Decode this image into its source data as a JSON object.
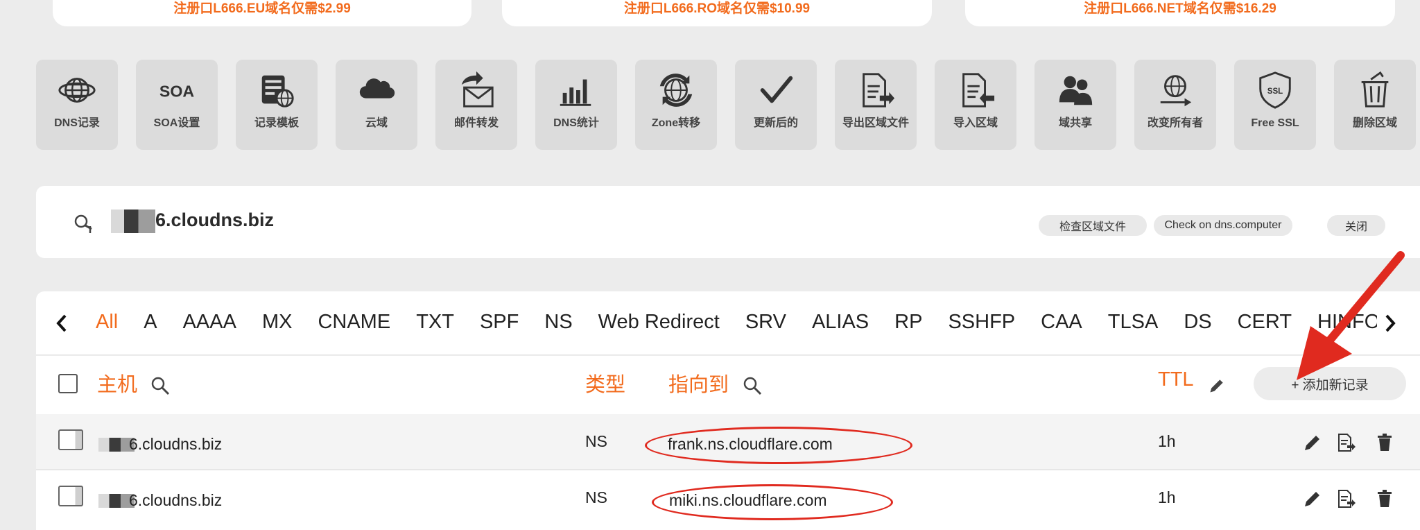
{
  "promos": [
    {
      "text": "注册口L666.EU域名仅需$2.99"
    },
    {
      "text": "注册口L666.RO域名仅需$10.99"
    },
    {
      "text": "注册口L666.NET域名仅需$16.29"
    }
  ],
  "tools": [
    {
      "label": "DNS记录",
      "icon": "globe-icon"
    },
    {
      "label": "SOA设置",
      "icon": "soa-icon",
      "icon_text": "SOA"
    },
    {
      "label": "记录模板",
      "icon": "template-icon"
    },
    {
      "label": "云域",
      "icon": "cloud-icon"
    },
    {
      "label": "邮件转发",
      "icon": "mail-forward-icon"
    },
    {
      "label": "DNS统计",
      "icon": "bar-stats-icon"
    },
    {
      "label": "Zone转移",
      "icon": "zone-transfer-icon"
    },
    {
      "label": "更新后的",
      "icon": "checkmark-icon"
    },
    {
      "label": "导出区域文件",
      "icon": "export-file-icon"
    },
    {
      "label": "导入区域",
      "icon": "import-file-icon"
    },
    {
      "label": "域共享",
      "icon": "users-icon"
    },
    {
      "label": "改变所有者",
      "icon": "change-owner-icon"
    },
    {
      "label": "Free SSL",
      "icon": "ssl-shield-icon",
      "icon_text": "SSL"
    },
    {
      "label": "删除区域",
      "icon": "trash-icon"
    }
  ],
  "domain": {
    "name": "6.cloudns.biz",
    "actions": {
      "check_zone": "检查区域文件",
      "check_dns_computer": "Check on dns.computer",
      "close": "关闭"
    }
  },
  "tabs": {
    "active": "All",
    "items": [
      "All",
      "A",
      "AAAA",
      "MX",
      "CNAME",
      "TXT",
      "SPF",
      "NS",
      "Web Redirect",
      "SRV",
      "ALIAS",
      "RP",
      "SSHFP",
      "CAA",
      "TLSA",
      "DS",
      "CERT",
      "HINFO"
    ]
  },
  "table": {
    "headers": {
      "host": "主机",
      "type": "类型",
      "points_to": "指向到",
      "ttl": "TTL"
    },
    "add_record": "+ 添加新记录",
    "rows": [
      {
        "host": "6.cloudns.biz",
        "type": "NS",
        "points_to": "frank.ns.cloudflare.com",
        "ttl": "1h"
      },
      {
        "host": "6.cloudns.biz",
        "type": "NS",
        "points_to": "miki.ns.cloudflare.com",
        "ttl": "1h"
      }
    ]
  },
  "colors": {
    "accent": "#f26b1d",
    "annotation": "#e02a1f",
    "tile_bg": "#dcdcdc",
    "page_bg": "#ececec"
  }
}
